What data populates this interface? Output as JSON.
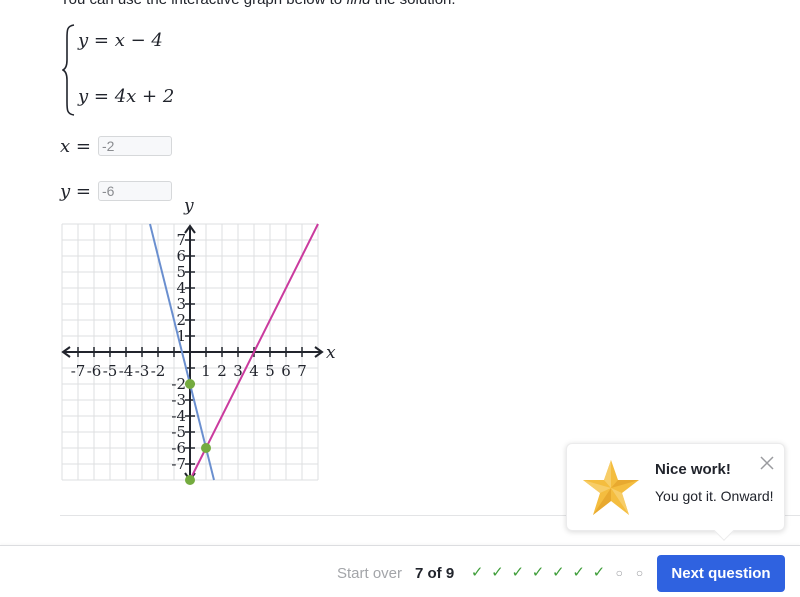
{
  "intro": {
    "before": "You can use the interactive graph below to ",
    "emph": "find",
    "after": " the solution."
  },
  "system": {
    "equations": [
      {
        "lhs": "y",
        "rhs": "x − 4"
      },
      {
        "lhs": "y",
        "rhs": "4x + 2"
      }
    ]
  },
  "answers": {
    "x": {
      "label": "x",
      "equals": "=",
      "value": "-2"
    },
    "y": {
      "label": "y",
      "equals": "=",
      "value": "-6"
    }
  },
  "chart_data": {
    "type": "line",
    "title": "",
    "xlabel": "x",
    "ylabel": "y",
    "xlim": [
      -8,
      8
    ],
    "ylim": [
      -8,
      8
    ],
    "grid": true,
    "x_tick_labels": [
      "-7",
      "-6",
      "-5",
      "-4",
      "-3",
      "-2",
      "1",
      "2",
      "3",
      "4",
      "5",
      "6",
      "7"
    ],
    "x_tick_values": [
      -7,
      -6,
      -5,
      -4,
      -3,
      -2,
      1,
      2,
      3,
      4,
      5,
      6,
      7
    ],
    "y_tick_labels": [
      "7",
      "6",
      "5",
      "4",
      "3",
      "2",
      "1",
      "-2",
      "-3",
      "-4",
      "-5",
      "-6",
      "-7"
    ],
    "y_tick_values": [
      7,
      6,
      5,
      4,
      3,
      2,
      1,
      -2,
      -3,
      -4,
      -5,
      -6,
      -7
    ],
    "series": [
      {
        "name": "blue-line",
        "color": "#6a8fcf",
        "slope": -4,
        "intercept": -2
      },
      {
        "name": "magenta-line",
        "color": "#ca3a9e",
        "slope": 2,
        "intercept": -8
      }
    ],
    "points": [
      {
        "x": 0,
        "y": -2,
        "color": "#74ab3f"
      },
      {
        "x": 1,
        "y": -6,
        "color": "#74ab3f"
      },
      {
        "x": 0,
        "y": -8,
        "color": "#74ab3f"
      }
    ]
  },
  "toast": {
    "title": "Nice work!",
    "message": "You got it. Onward!",
    "icon": "star-icon"
  },
  "footer": {
    "start_over": "Start over",
    "progress_text": "7 of 9",
    "progress": {
      "completed": 7,
      "total": 9
    },
    "next_label": "Next question"
  },
  "colors": {
    "accent": "#2f62e0",
    "success": "#3f9e3a",
    "star": "#f4bd3f"
  }
}
